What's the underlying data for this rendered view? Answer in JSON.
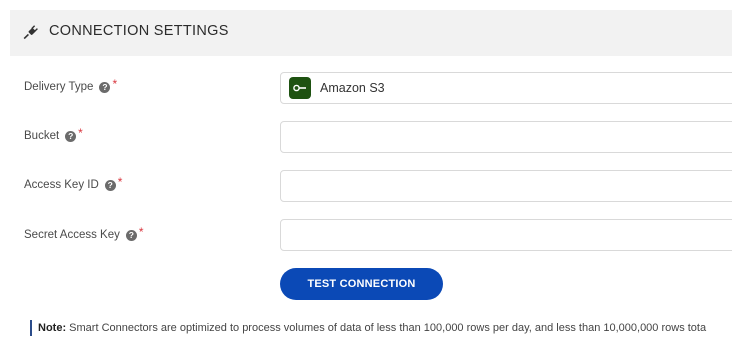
{
  "header": {
    "title": "CONNECTION SETTINGS",
    "icon": "plug-icon"
  },
  "fields": [
    {
      "label": "Delivery Type",
      "required_mark": "*",
      "help": "?",
      "value": "Amazon S3",
      "icon": "amazon-s3-icon"
    },
    {
      "label": "Bucket",
      "required_mark": "*",
      "help": "?",
      "value": ""
    },
    {
      "label": "Access Key ID",
      "required_mark": "*",
      "help": "?",
      "value": ""
    },
    {
      "label": "Secret Access Key",
      "required_mark": "*",
      "help": "?",
      "value": ""
    }
  ],
  "actions": {
    "test_connection_label": "TEST CONNECTION"
  },
  "note": {
    "prefix": "Note:",
    "text": "Smart Connectors are optimized to process volumes of data of less than 100,000 rows per day, and less than 10,000,000 rows tota"
  },
  "colors": {
    "button": "#0b49b6",
    "required": "#d9363e",
    "s3_icon_bg": "#1e5211",
    "header_bg": "#f2f2f2"
  }
}
